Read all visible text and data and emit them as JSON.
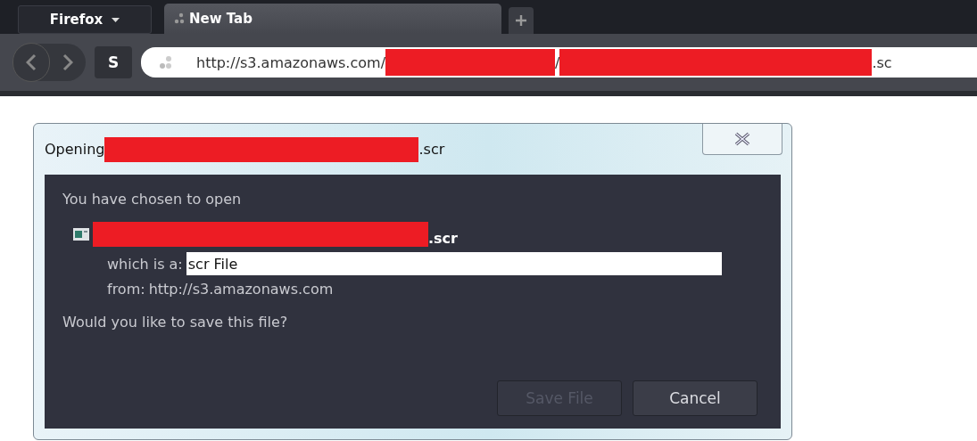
{
  "browser": {
    "menu_button": {
      "label": "Firefox"
    },
    "tabs": [
      {
        "label": "New Tab",
        "selected": true
      }
    ],
    "sync_button": {
      "label": "S"
    },
    "address_bar": {
      "segments": [
        {
          "kind": "text",
          "text": "http://s3.amazonaws.com/"
        },
        {
          "kind": "redacted"
        },
        {
          "kind": "text",
          "text": "/"
        },
        {
          "kind": "redacted"
        },
        {
          "kind": "text",
          "text": ".sc"
        }
      ]
    }
  },
  "dialog": {
    "title": [
      {
        "kind": "text",
        "text": "Opening"
      },
      {
        "kind": "redacted"
      },
      {
        "kind": "text",
        "text": ".scr"
      }
    ],
    "intro": "You have chosen to open",
    "file_name": [
      {
        "kind": "redacted"
      },
      {
        "kind": "text",
        "text": ".scr"
      }
    ],
    "type_label": "which is a:",
    "type_value": "scr File",
    "from_label": "from:",
    "from_value": "http://s3.amazonaws.com",
    "question": "Would you like to save this file?",
    "buttons": [
      {
        "label": "Save File",
        "disabled": true
      },
      {
        "label": "Cancel",
        "disabled": false
      }
    ]
  }
}
